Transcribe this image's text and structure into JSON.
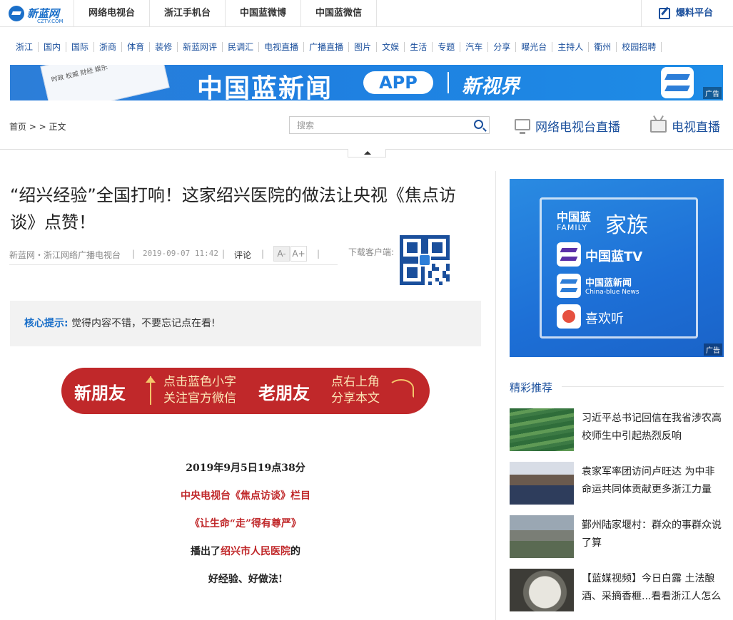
{
  "logo": {
    "name": "新蓝网",
    "domain": "CZTV.COM"
  },
  "topnav": [
    "网络电视台",
    "浙江手机台",
    "中国蓝微博",
    "中国蓝微信"
  ],
  "baoliao": "爆料平台",
  "channels": [
    "浙江",
    "国内",
    "国际",
    "浙商",
    "体育",
    "装修",
    "新蓝网评",
    "民调汇",
    "电视直播",
    "广播直播",
    "图片",
    "文娱",
    "生活",
    "专题",
    "汽车",
    "分享",
    "曝光台",
    "主持人",
    "衢州",
    "校园招聘"
  ],
  "banner": {
    "title": "中国蓝新闻",
    "app": "APP",
    "slogan": "新视界",
    "ad": "广告",
    "phone_text": "时政  权威  财经  娱乐"
  },
  "breadcrumb": "首页 > > 正文",
  "search": {
    "placeholder": "搜索"
  },
  "live": {
    "network_tv": "网络电视台直播",
    "tv": "电视直播"
  },
  "article": {
    "headline": "“绍兴经验”全国打响！这家绍兴医院的做法让央视《焦点访谈》点赞！",
    "source": "新蓝网・浙江网络广播电视台",
    "date": "2019-09-07 11:42",
    "comment": "评论",
    "font_small": "A-",
    "font_big": "A+",
    "download": "下载客户端:",
    "hint_key": "核心提示:",
    "hint_val": "觉得内容不错，不要忘记点在看!",
    "promo": {
      "new_friend": "新朋友",
      "new_tip_1": "点击蓝色小字",
      "new_tip_2": "关注官方微信",
      "old_friend": "老朋友",
      "old_tip_1": "点右上角",
      "old_tip_2": "分享本文"
    },
    "body": {
      "line1": "2019年9月5日19点38分",
      "line2": "中央电视台《焦点访谈》栏目",
      "line3": "《让生命“走”得有尊严》",
      "line4_pre": "播出了",
      "line4_red": "绍兴市人民医院",
      "line4_post": "的",
      "line5": "好经验、好做法!"
    }
  },
  "sidebar": {
    "ad": {
      "t1": "中国蓝",
      "t2": "FAMILY",
      "t3": "家族",
      "tv": "中国蓝TV",
      "news": "中国蓝新闻",
      "news_en": "China-blue News",
      "listen": "喜欢听",
      "tag": "广告"
    },
    "rec_title": "精彩推荐",
    "items": [
      {
        "text": "习近平总书记回信在我省涉农高校师生中引起热烈反响"
      },
      {
        "text": "袁家军率团访问卢旺达 为中非命运共同体贡献更多浙江力量"
      },
      {
        "text": "鄞州陆家堰村：群众的事群众说了算"
      },
      {
        "text": "【蓝媒视频】今日白露 土法酿酒、采摘香榧...看看浙江人怎么"
      }
    ]
  },
  "colors": {
    "brand_blue": "#1a4f9c",
    "accent_red": "#c0282a",
    "banner_blue": "#1f7fe0"
  }
}
